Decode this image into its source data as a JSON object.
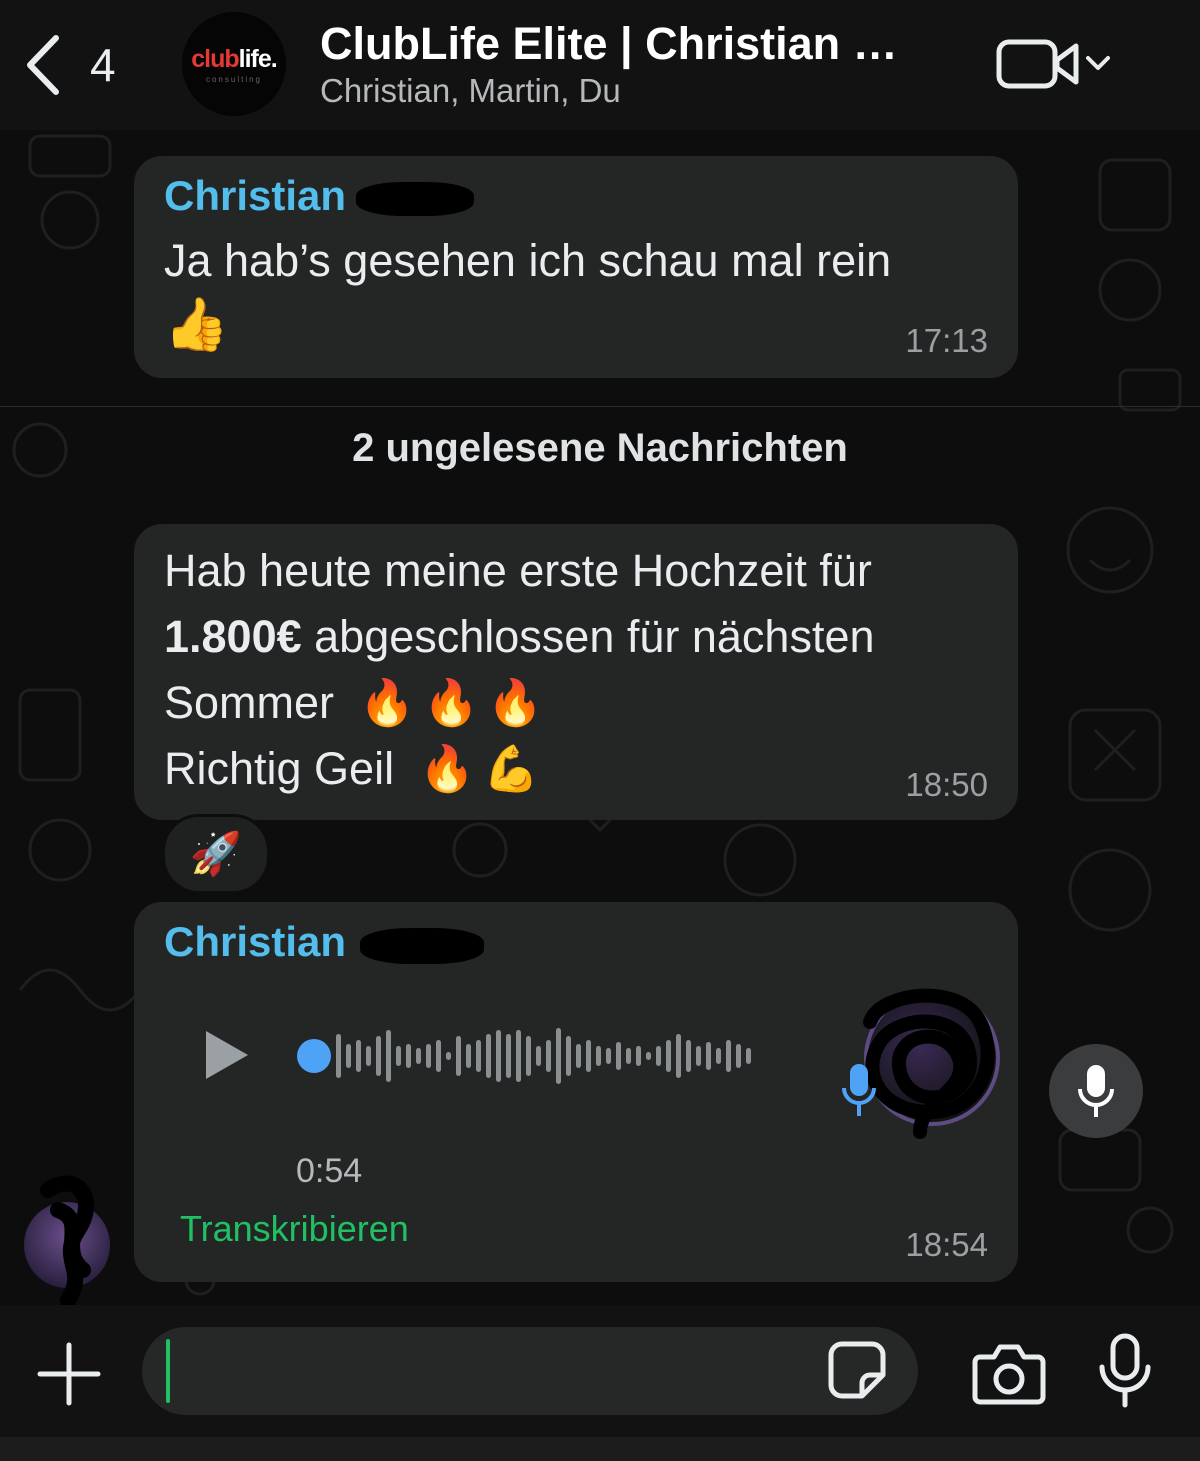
{
  "header": {
    "back_count": "4",
    "group_logo_text_red": "club",
    "group_logo_text_white": "life.",
    "group_logo_sub": "consulting",
    "title": "ClubLife Elite | Christian …",
    "subtitle": "Christian, Martin, Du"
  },
  "messages": [
    {
      "sender": "Christian",
      "text": "Ja hab’s gesehen ich schau mal rein",
      "emoji": "👍",
      "time": "17:13"
    },
    {
      "divider": "2 ungelesene Nachrichten"
    },
    {
      "line1": "Hab heute meine erste Hochzeit für",
      "amount": "1.800€",
      "line2_rest": " abgeschlossen für nächsten",
      "line3": "Sommer",
      "line3_emoji": "🔥🔥🔥",
      "line4": "Richtig Geil",
      "line4_emoji": "🔥💪",
      "time": "18:50",
      "reaction": "🚀"
    },
    {
      "sender": "Christian",
      "type": "voice",
      "duration": "0:54",
      "transcribe_label": "Transkribieren",
      "time": "18:54"
    }
  ],
  "composer": {
    "placeholder": ""
  },
  "icons": {
    "back": "chevron-left-icon",
    "video": "video-camera-icon",
    "plus": "plus-icon",
    "sticker": "sticker-icon",
    "camera": "camera-icon",
    "mic": "microphone-icon",
    "play": "play-icon"
  },
  "colors": {
    "sender_name": "#53bdeb",
    "transcribe": "#21c063",
    "bubble": "#242626",
    "background": "#0d0d0d"
  }
}
